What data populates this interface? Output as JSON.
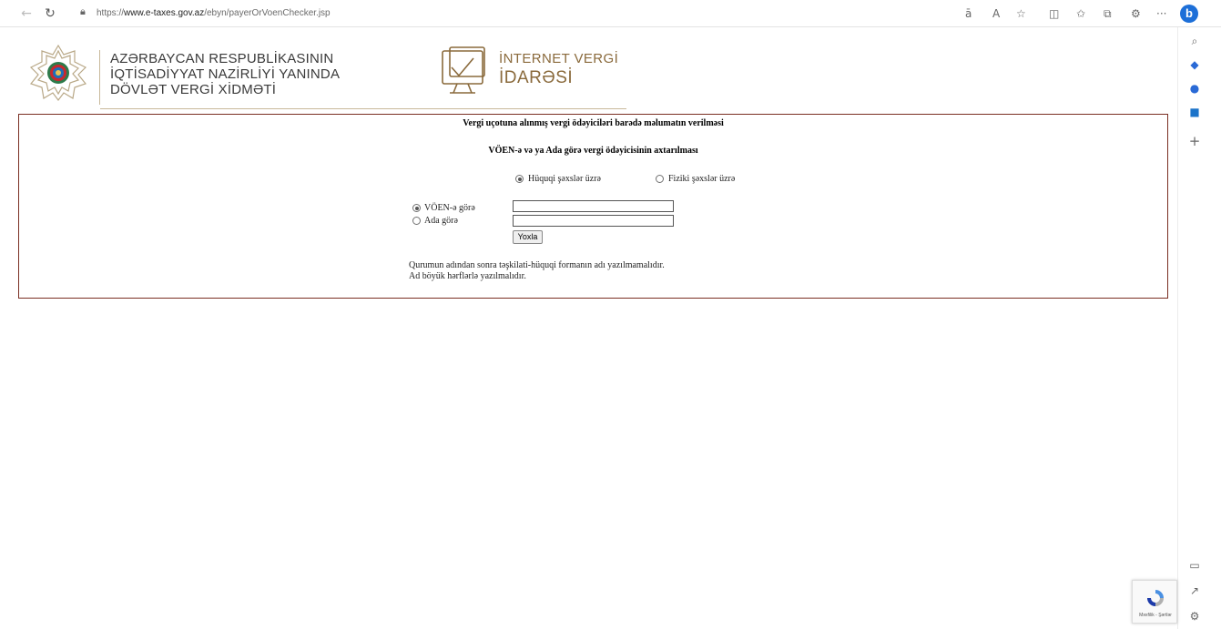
{
  "browser": {
    "url_prefix": "https://",
    "url_domain": "www.e-taxes.gov.az",
    "url_path": "/ebyn/payerOrVoenChecker.jsp",
    "bing_label": "b"
  },
  "header": {
    "org_line1": "AZƏRBAYCAN RESPUBLİKASININ",
    "org_line2": "İQTİSADİYYAT NAZİRLİYİ YANINDA",
    "org_line3": "DÖVLƏT VERGİ XİDMƏTİ",
    "ivi_line1": "İNTERNET VERGİ",
    "ivi_line2": "İDARƏSİ",
    "accent_color": "#8a6a3c"
  },
  "form": {
    "title": "Vergi uçotuna alınmış vergi ödəyiciləri barədə məlumatın verilməsi",
    "subtitle": "VÖEN-ə və ya Ada görə vergi ödəyicisinin axtarılması",
    "type_option_legal": "Hüquqi şəxslər üzrə",
    "type_option_physical": "Fiziki şəxslər üzrə",
    "selected_type": "legal",
    "search_option_voen": "VÖEN-ə görə",
    "search_option_name": "Ada görə",
    "selected_search": "voen",
    "voen_value": "",
    "name_value": "",
    "submit_label": "Yoxla",
    "note_line1": "Qurumun adından sonra təşkilati-hüquqi formanın adı yazılmamalıdır.",
    "note_line2": "Ad böyük hərflərlə yazılmalıdır.",
    "border_color": "#7a2e22"
  },
  "recaptcha": {
    "text": "Məxfilik - Şərtlər"
  }
}
